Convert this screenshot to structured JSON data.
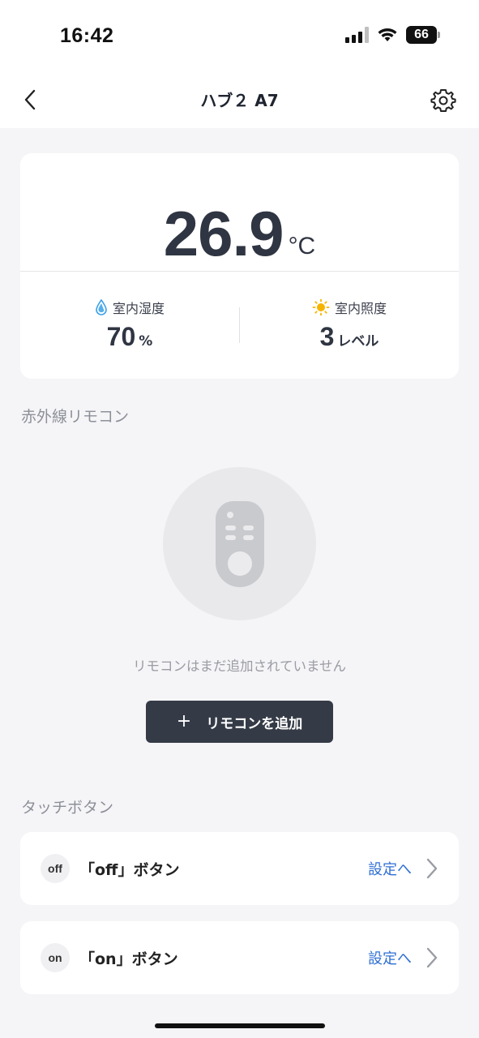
{
  "status_bar": {
    "time": "16:42",
    "battery": "66"
  },
  "nav": {
    "title": "ハブ２ A7",
    "back_icon": "chevron-left-icon",
    "settings_icon": "gear-icon"
  },
  "sensor": {
    "temperature": "26.9",
    "temperature_unit": "°C",
    "humidity_label": "室内湿度",
    "humidity_value": "70",
    "humidity_unit": "%",
    "light_label": "室内照度",
    "light_value": "3",
    "light_unit": "レベル"
  },
  "ir_remote": {
    "section_title": "赤外線リモコン",
    "empty_text": "リモコンはまだ追加されていません",
    "add_button_label": "リモコンを追加",
    "add_icon": "plus-icon"
  },
  "touch_buttons": {
    "section_title": "タッチボタン",
    "items": [
      {
        "badge": "off",
        "label": "「off」ボタン",
        "link": "設定へ"
      },
      {
        "badge": "on",
        "label": "「on」ボタン",
        "link": "設定へ"
      }
    ]
  },
  "colors": {
    "background": "#f5f5f7",
    "card": "#ffffff",
    "primary_text": "#2f3542",
    "button_dark": "#343a46",
    "link_blue": "#2f6fd3",
    "humidity_icon": "#3aa0e8",
    "light_icon": "#f5b400"
  }
}
